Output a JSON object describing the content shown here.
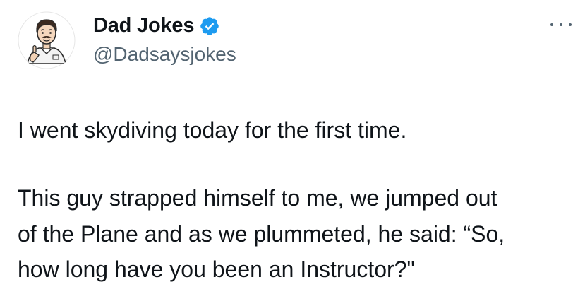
{
  "author": {
    "display_name": "Dad Jokes",
    "handle": "@Dadsaysjokes",
    "verified": true,
    "verified_icon": "verified-badge-icon",
    "accent_color": "#1d9bf0"
  },
  "menu": {
    "icon": "more-options-icon"
  },
  "tweet": {
    "paragraph1": "I went skydiving today for the first time.",
    "paragraph2_lines": [
      "This guy strapped himself to me, we jumped out",
      "of the Plane and as we plummeted, he said: “So,",
      "how long have you been an Instructor?\""
    ]
  }
}
